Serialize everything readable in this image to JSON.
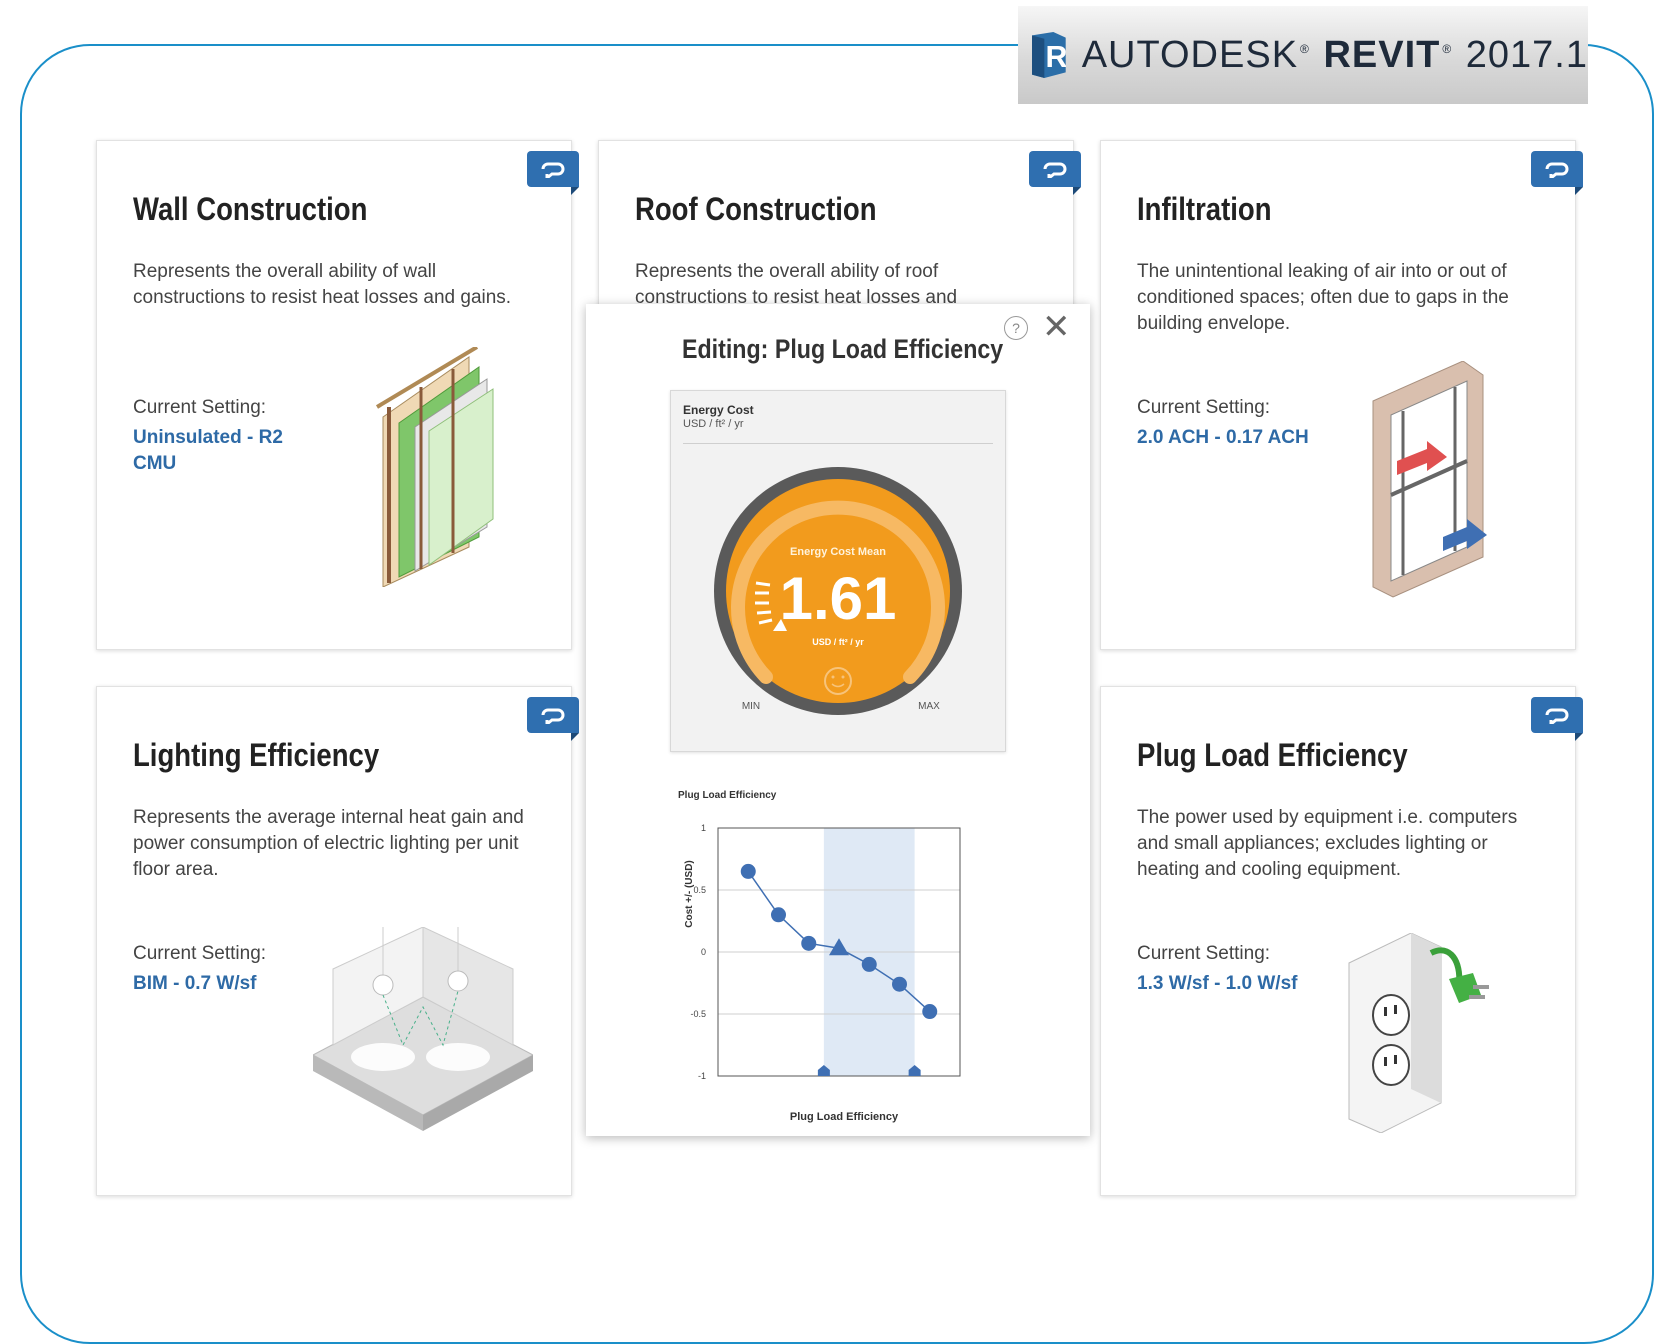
{
  "brand": {
    "name": "AUTODESK",
    "product": "REVIT",
    "version": "2017.1",
    "reg": "®"
  },
  "cards": [
    {
      "title": "Wall Construction",
      "description": "Represents the overall ability of wall constructions to resist heat losses and gains.",
      "setting_label": "Current Setting:",
      "setting_value": "Uninsulated - R2 CMU"
    },
    {
      "title": "Roof Construction",
      "description": "Represents the overall ability of roof constructions to resist heat losses and",
      "setting_label": "",
      "setting_value": ""
    },
    {
      "title": "Infiltration",
      "description": "The unintentional leaking of air into or out of conditioned spaces; often due to gaps in the building envelope.",
      "setting_label": "Current Setting:",
      "setting_value": "2.0 ACH - 0.17 ACH"
    },
    {
      "title": "Lighting Efficiency",
      "description": "Represents the average internal heat gain and power consumption of electric lighting per unit floor area.",
      "setting_label": "Current Setting:",
      "setting_value": "BIM - 0.7 W/sf"
    },
    {
      "title": "Plug Load Efficiency",
      "description": "The power used by equipment i.e. computers and small appliances; excludes lighting or heating and cooling equipment.",
      "setting_label": "Current Setting:",
      "setting_value": "1.3 W/sf - 1.0 W/sf"
    }
  ],
  "modal": {
    "title": "Editing: Plug Load Efficiency",
    "help_label": "?",
    "close_label": "✕",
    "gauge": {
      "panel_title": "Energy Cost",
      "panel_unit": "USD / ft² / yr",
      "label": "Energy Cost Mean",
      "value": "1.61",
      "unit": "USD / ft² / yr",
      "min_label": "MIN",
      "max_label": "MAX",
      "color": "#f29b1d"
    }
  },
  "chart_data": {
    "type": "line",
    "title": "Plug Load Efficiency",
    "xlabel": "Plug Load Efficiency",
    "ylabel": "Cost +/- (USD)",
    "ylim": [
      -1,
      1
    ],
    "yticks": [
      -1,
      -0.5,
      0,
      0.5,
      1
    ],
    "ytick_labels": [
      "-1",
      "-0.5",
      "0",
      "0.5",
      "1"
    ],
    "x": [
      1,
      2,
      3,
      4,
      5,
      6,
      7
    ],
    "xlim": [
      0,
      8
    ],
    "values": [
      0.65,
      0.3,
      0.07,
      0.03,
      -0.1,
      -0.26,
      -0.48
    ],
    "current_index": 3,
    "selected_range": [
      3.5,
      6.5
    ],
    "series_color": "#3f6fb3",
    "band_color": "#dfe9f5",
    "grid": true
  }
}
